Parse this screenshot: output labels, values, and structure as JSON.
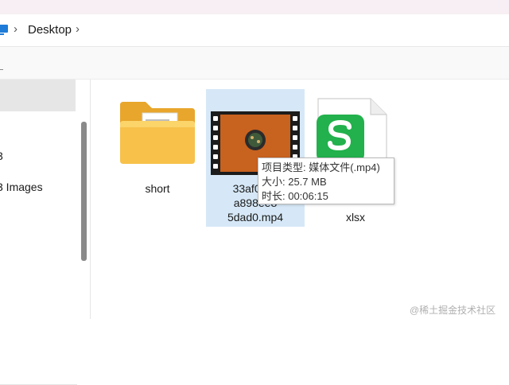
{
  "address_bar": {
    "crumb": "Desktop",
    "separator": "›"
  },
  "nav": {
    "items": [
      {
        "label": "        "
      },
      {
        "label": " "
      },
      {
        "label": "3"
      },
      {
        "label": "3 Images"
      }
    ]
  },
  "files": [
    {
      "name": "short",
      "kind": "folder-icon"
    },
    {
      "name_lines": [
        "33af0c9c",
        "a898ee8",
        "5dad0.mp4"
      ],
      "kind": "video-icon"
    },
    {
      "name_lines": [
        "xlsx"
      ],
      "kind": "spreadsheet-icon"
    }
  ],
  "tooltip": {
    "line1": "项目类型: 媒体文件(.mp4)",
    "line2": "大小: 25.7 MB",
    "line3": "时长: 00:06:15"
  },
  "watermark": "@稀土掘金技术社区",
  "colors": {
    "selection": "#d6e8f7",
    "folder": "#f4b942",
    "wps_green": "#22b14c"
  }
}
